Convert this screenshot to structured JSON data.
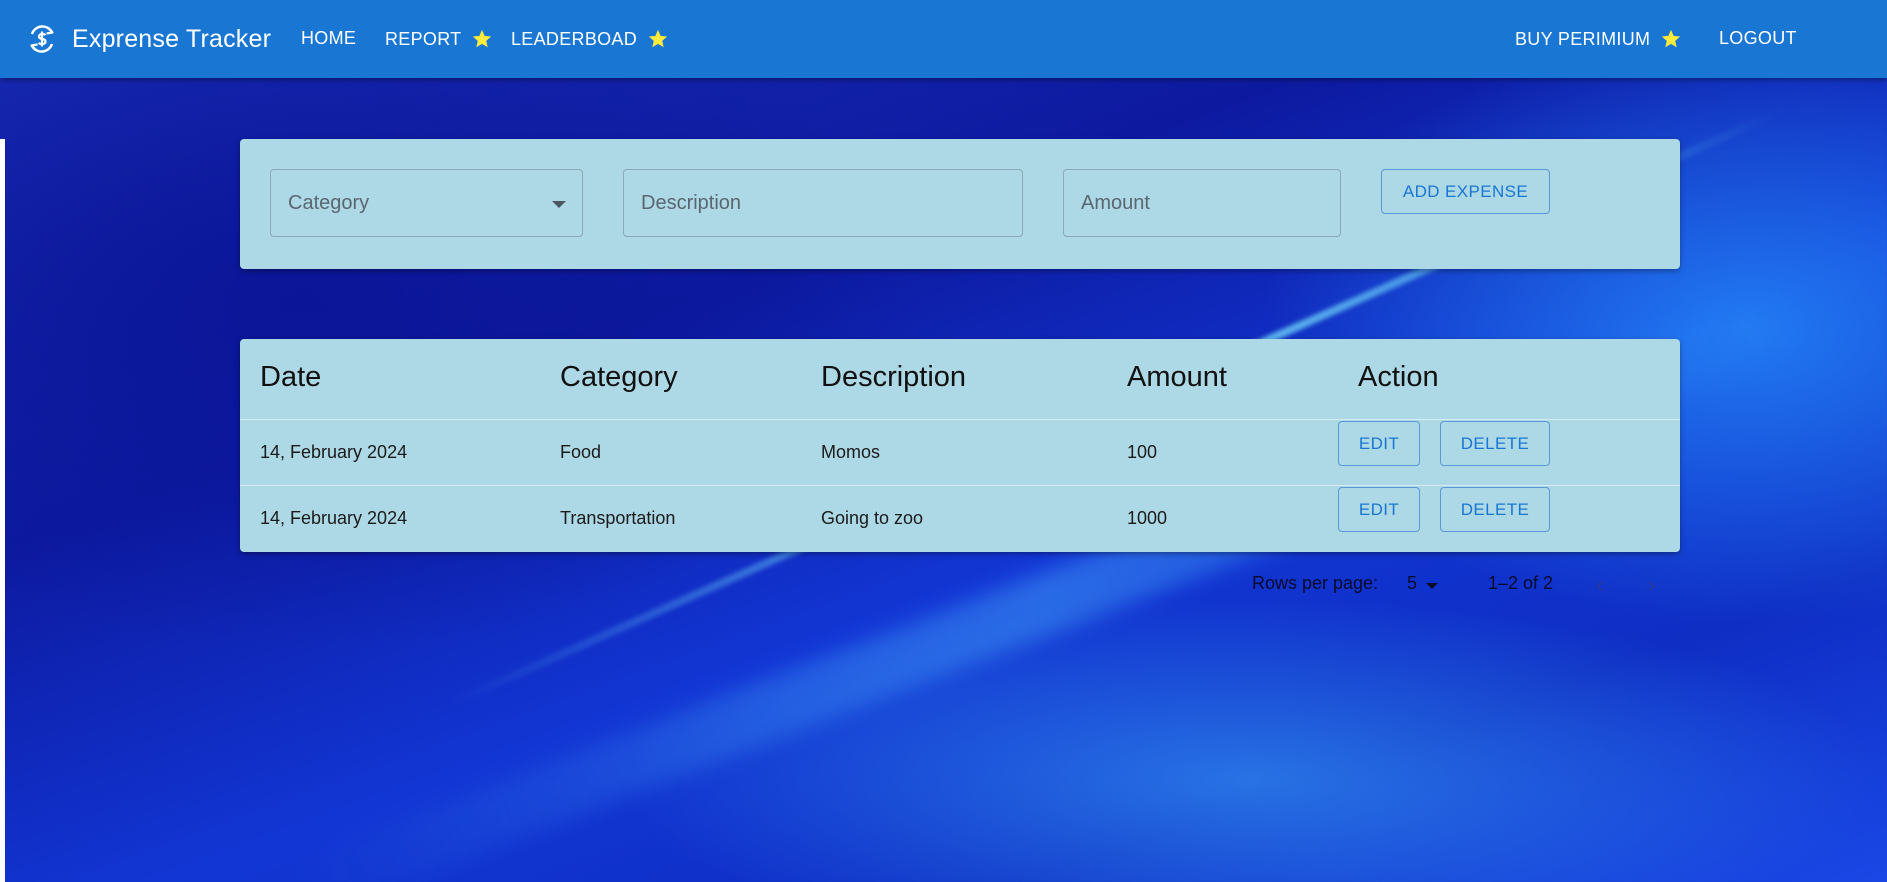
{
  "app": {
    "title": "Exprense Tracker"
  },
  "nav": {
    "home": "HOME",
    "report": "REPORT",
    "leaderboard": "LEADERBOAD",
    "buy_premium": "BUY PERIMIUM",
    "logout": "LOGOUT"
  },
  "form": {
    "category_placeholder": "Category",
    "description_placeholder": "Description",
    "amount_placeholder": "Amount",
    "add_label": "ADD EXPENSE"
  },
  "table": {
    "headers": [
      "Date",
      "Category",
      "Description",
      "Amount",
      "Action"
    ],
    "rows": [
      {
        "date": "14, February 2024",
        "category": "Food",
        "description": "Momos",
        "amount": "100",
        "edit": "EDIT",
        "delete": "DELETE"
      },
      {
        "date": "14, February 2024",
        "category": "Transportation",
        "description": "Going to zoo",
        "amount": "1000",
        "edit": "EDIT",
        "delete": "DELETE"
      }
    ]
  },
  "pagination": {
    "rows_per_page_label": "Rows per page:",
    "rows_per_page_value": "5",
    "range": "1–2 of 2"
  },
  "colors": {
    "appbar": "#1976d2",
    "card": "#add8e6",
    "star": "#ffeb3b",
    "accent": "#1976d2"
  },
  "icons": {
    "brand": "currency-exchange-icon",
    "premium_marker": "star-icon",
    "prev": "chevron-left-icon",
    "next": "chevron-right-icon"
  }
}
